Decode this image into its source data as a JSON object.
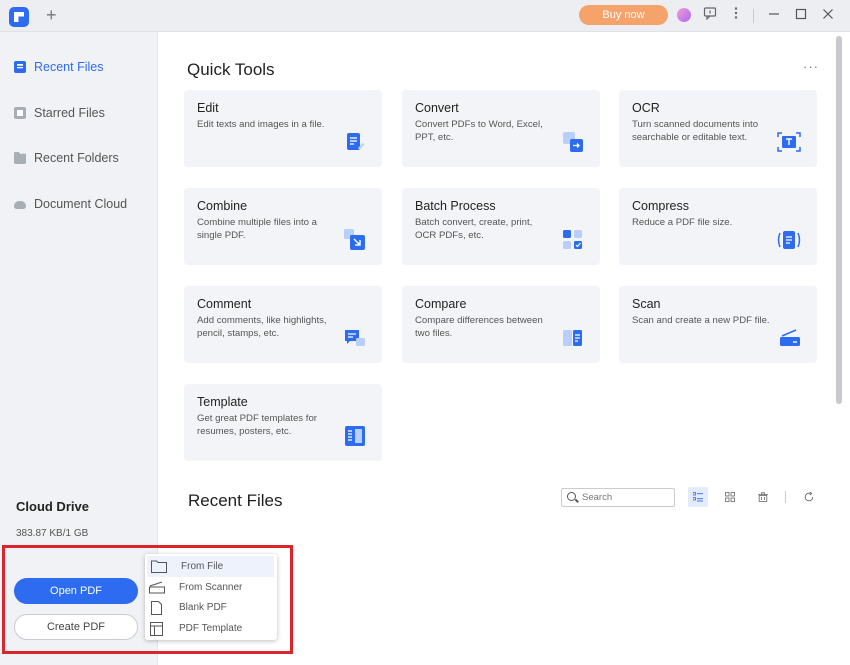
{
  "titlebar": {
    "new_tab": "+",
    "buy_now": "Buy now",
    "icons": [
      "app-logo",
      "avatar",
      "feedback-icon",
      "kebab-menu-icon",
      "minimize-icon",
      "maximize-icon",
      "close-icon"
    ]
  },
  "sidebar": {
    "items": [
      {
        "label": "Recent Files",
        "icon": "recent-files-icon",
        "active": true
      },
      {
        "label": "Starred Files",
        "icon": "star-icon",
        "active": false
      },
      {
        "label": "Recent Folders",
        "icon": "folder-icon",
        "active": false
      },
      {
        "label": "Document Cloud",
        "icon": "cloud-icon",
        "active": false
      }
    ],
    "cloud_drive_title": "Cloud Drive",
    "cloud_usage": "383.87 KB/1 GB",
    "cloud_usage_fraction": 0.0004,
    "open_pdf": "Open PDF",
    "create_pdf": "Create PDF"
  },
  "create_menu": {
    "items": [
      {
        "label": "From File",
        "icon": "folder-icon",
        "hovered": true
      },
      {
        "label": "From Scanner",
        "icon": "scanner-icon",
        "hovered": false
      },
      {
        "label": "Blank PDF",
        "icon": "blank-page-icon",
        "hovered": false
      },
      {
        "label": "PDF Template",
        "icon": "template-icon",
        "hovered": false
      }
    ],
    "highlight_color": "#d9252b"
  },
  "main": {
    "quick_tools_title": "Quick Tools",
    "more": "···",
    "tools": [
      {
        "title": "Edit",
        "desc": "Edit texts and images in a file."
      },
      {
        "title": "Convert",
        "desc": "Convert PDFs to Word, Excel, PPT, etc."
      },
      {
        "title": "OCR",
        "desc": "Turn scanned documents into searchable or editable text."
      },
      {
        "title": "Combine",
        "desc": "Combine multiple files into a single PDF."
      },
      {
        "title": "Batch Process",
        "desc": "Batch convert, create, print, OCR PDFs, etc."
      },
      {
        "title": "Compress",
        "desc": "Reduce a PDF file size."
      },
      {
        "title": "Comment",
        "desc": "Add comments, like highlights, pencil, stamps, etc."
      },
      {
        "title": "Compare",
        "desc": "Compare differences between two files."
      },
      {
        "title": "Scan",
        "desc": "Scan and create a new PDF file."
      },
      {
        "title": "Template",
        "desc": "Get great PDF templates for resumes, posters, etc."
      }
    ],
    "recent_files_title": "Recent Files",
    "search_placeholder": "Search"
  },
  "colors": {
    "accent": "#2d6bf0",
    "buy_button": "#f5a26b"
  }
}
